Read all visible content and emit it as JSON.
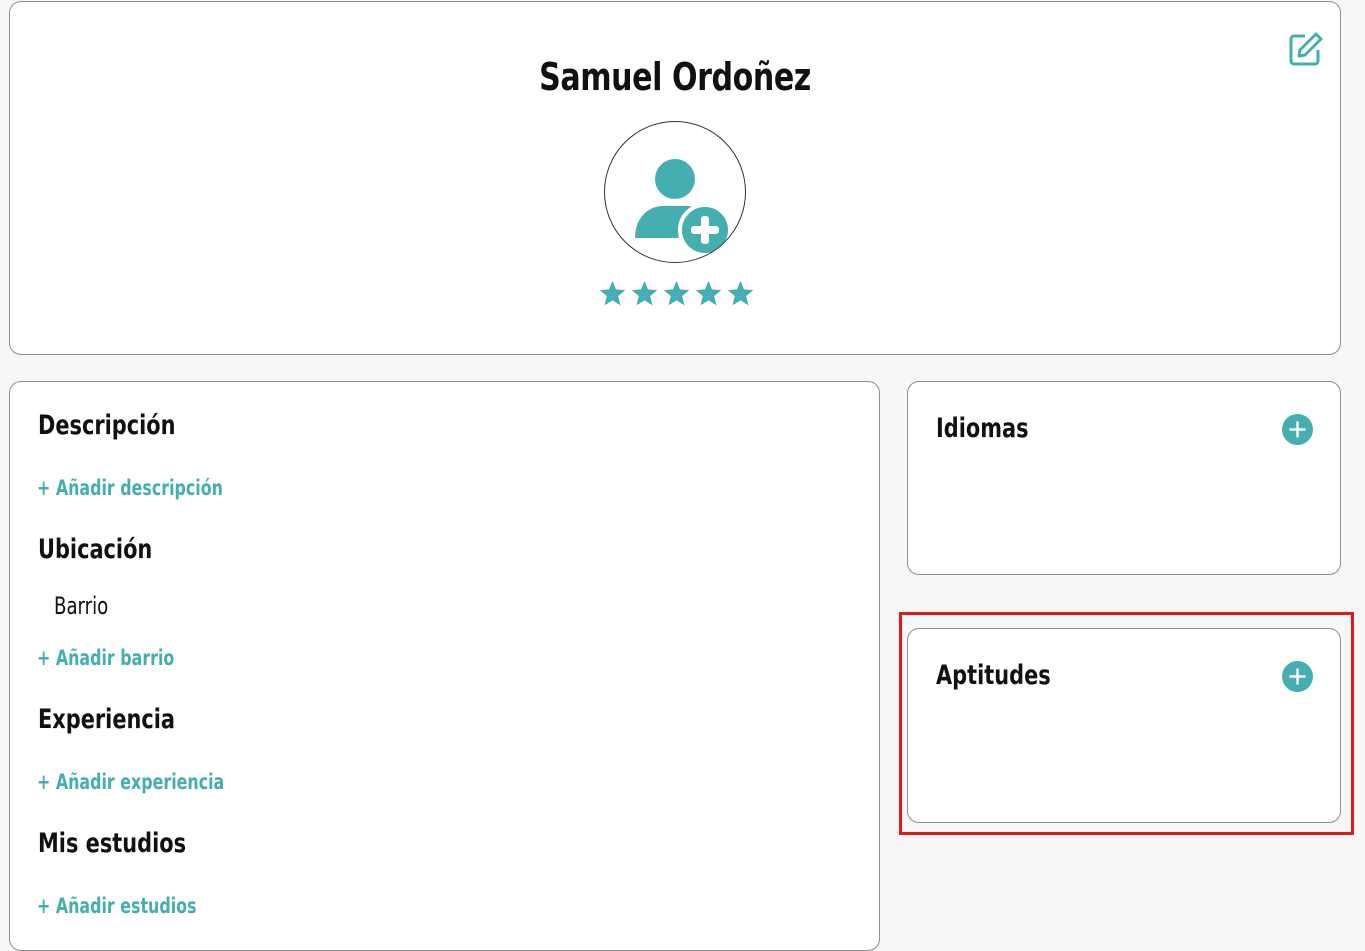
{
  "profile": {
    "name": "Samuel Ordoñez",
    "rating": 5,
    "rating_max": 5,
    "icons": {
      "edit": "edit-icon",
      "avatar": "add-user-icon",
      "star": "star-icon"
    }
  },
  "details": {
    "description": {
      "title": "Descripción",
      "add_label": "+ Añadir descripción"
    },
    "location": {
      "title": "Ubicación",
      "field_label": "Barrio",
      "add_label": "+ Añadir barrio"
    },
    "experience": {
      "title": "Experiencia",
      "add_label": "+ Añadir experiencia"
    },
    "studies": {
      "title": "Mis estudios",
      "add_label": "+ Añadir estudios"
    }
  },
  "languages": {
    "title": "Idiomas",
    "add_icon": "plus-circle-icon"
  },
  "skills": {
    "title": "Aptitudes",
    "add_icon": "plus-circle-icon",
    "highlighted": true
  },
  "colors": {
    "accent": "#45aeb0",
    "highlight": "#e0191f",
    "text": "#111111",
    "border": "#8e8e8e",
    "background": "#f7f7f7"
  }
}
